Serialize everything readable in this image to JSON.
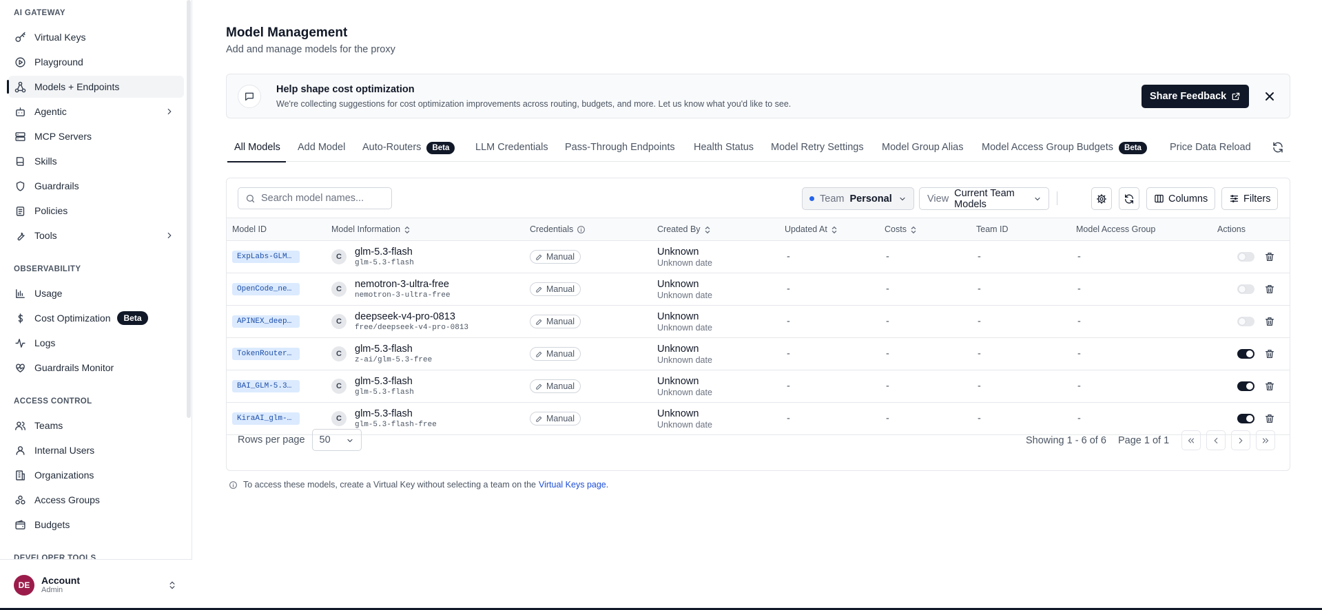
{
  "sidebar": {
    "sections": [
      {
        "title": "AI GATEWAY",
        "items": [
          {
            "label": "Virtual Keys",
            "icon": "key-icon"
          },
          {
            "label": "Playground",
            "icon": "play-circle-icon"
          },
          {
            "label": "Models + Endpoints",
            "icon": "network-icon",
            "active": true
          },
          {
            "label": "Agentic",
            "icon": "bot-icon",
            "expandable": true
          },
          {
            "label": "MCP Servers",
            "icon": "server-icon"
          },
          {
            "label": "Skills",
            "icon": "book-icon"
          },
          {
            "label": "Guardrails",
            "icon": "shield-icon"
          },
          {
            "label": "Policies",
            "icon": "clipboard-icon"
          },
          {
            "label": "Tools",
            "icon": "wrench-icon",
            "expandable": true
          }
        ]
      },
      {
        "title": "OBSERVABILITY",
        "items": [
          {
            "label": "Usage",
            "icon": "chart-icon"
          },
          {
            "label": "Cost Optimization",
            "icon": "dollar-icon",
            "badge": "Beta"
          },
          {
            "label": "Logs",
            "icon": "activity-icon"
          },
          {
            "label": "Guardrails Monitor",
            "icon": "heart-pulse-icon"
          }
        ]
      },
      {
        "title": "ACCESS CONTROL",
        "items": [
          {
            "label": "Teams",
            "icon": "users-icon"
          },
          {
            "label": "Internal Users",
            "icon": "user-icon"
          },
          {
            "label": "Organizations",
            "icon": "building-icon"
          },
          {
            "label": "Access Groups",
            "icon": "groups-icon"
          },
          {
            "label": "Budgets",
            "icon": "wallet-icon"
          }
        ]
      },
      {
        "title": "DEVELOPER TOOLS",
        "items": []
      }
    ],
    "account": {
      "initials": "DE",
      "name": "Account",
      "role": "Admin"
    }
  },
  "header": {
    "title": "Model Management",
    "subtitle": "Add and manage models for the proxy"
  },
  "banner": {
    "title": "Help shape cost optimization",
    "text": "We're collecting suggestions for cost optimization improvements across routing, budgets, and more. Let us know what you'd like to see.",
    "button": "Share Feedback"
  },
  "tabs": [
    {
      "label": "All Models",
      "active": true
    },
    {
      "label": "Add Model"
    },
    {
      "label": "Auto-Routers",
      "badge": "Beta"
    },
    {
      "label": "LLM Credentials"
    },
    {
      "label": "Pass-Through Endpoints"
    },
    {
      "label": "Health Status"
    },
    {
      "label": "Model Retry Settings"
    },
    {
      "label": "Model Group Alias"
    },
    {
      "label": "Model Access Group Budgets",
      "badge": "Beta"
    },
    {
      "label": "Price Data Reload"
    }
  ],
  "toolbar": {
    "search_placeholder": "Search model names...",
    "team_label": "Team",
    "team_value": "Personal",
    "view_label": "View",
    "view_value": "Current Team Models",
    "columns_label": "Columns",
    "filters_label": "Filters"
  },
  "table": {
    "columns": [
      "Model ID",
      "Model Information",
      "Credentials",
      "Created By",
      "Updated At",
      "Costs",
      "Team ID",
      "Model Access Group",
      "Actions"
    ],
    "rows": [
      {
        "model_id": "ExpLabs-GLM…",
        "provider_initial": "C",
        "name": "glm-5.3-flash",
        "sub": "glm-5.3-flash",
        "credentials": "Manual",
        "created_by": "Unknown",
        "created_date": "Unknown date",
        "updated_at": "-",
        "costs": "-",
        "team_id": "-",
        "access_group": "-",
        "enabled": false
      },
      {
        "model_id": "OpenCode_ne…",
        "provider_initial": "C",
        "name": "nemotron-3-ultra-free",
        "sub": "nemotron-3-ultra-free",
        "credentials": "Manual",
        "created_by": "Unknown",
        "created_date": "Unknown date",
        "updated_at": "-",
        "costs": "-",
        "team_id": "-",
        "access_group": "-",
        "enabled": false
      },
      {
        "model_id": "APINEX_deep…",
        "provider_initial": "C",
        "name": "deepseek-v4-pro-0813",
        "sub": "free/deepseek-v4-pro-0813",
        "credentials": "Manual",
        "created_by": "Unknown",
        "created_date": "Unknown date",
        "updated_at": "-",
        "costs": "-",
        "team_id": "-",
        "access_group": "-",
        "enabled": false
      },
      {
        "model_id": "TokenRouter…",
        "provider_initial": "C",
        "name": "glm-5.3-flash",
        "sub": "z-ai/glm-5.3-free",
        "credentials": "Manual",
        "created_by": "Unknown",
        "created_date": "Unknown date",
        "updated_at": "-",
        "costs": "-",
        "team_id": "-",
        "access_group": "-",
        "enabled": true
      },
      {
        "model_id": "BAI_GLM-5.3…",
        "provider_initial": "C",
        "name": "glm-5.3-flash",
        "sub": "glm-5.3-flash",
        "credentials": "Manual",
        "created_by": "Unknown",
        "created_date": "Unknown date",
        "updated_at": "-",
        "costs": "-",
        "team_id": "-",
        "access_group": "-",
        "enabled": true
      },
      {
        "model_id": "KiraAI_glm-…",
        "provider_initial": "C",
        "name": "glm-5.3-flash",
        "sub": "glm-5.3-flash-free",
        "credentials": "Manual",
        "created_by": "Unknown",
        "created_date": "Unknown date",
        "updated_at": "-",
        "costs": "-",
        "team_id": "-",
        "access_group": "-",
        "enabled": true
      }
    ]
  },
  "pagination": {
    "rows_per_page_label": "Rows per page",
    "rows_per_page": "50",
    "showing": "Showing 1 - 6 of 6",
    "page": "Page 1 of 1"
  },
  "note": {
    "text": "To access these models, create a Virtual Key without selecting a team on the",
    "link": "Virtual Keys page."
  }
}
